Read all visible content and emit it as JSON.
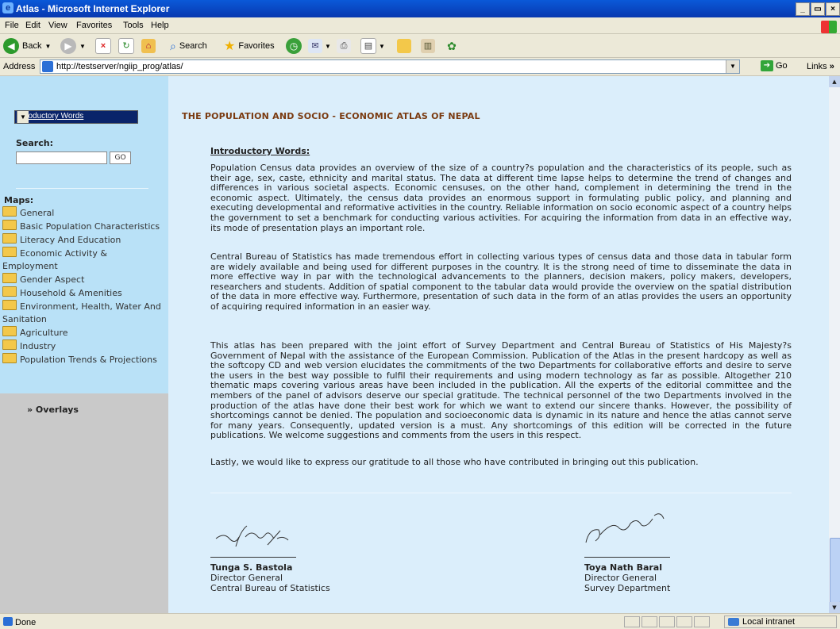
{
  "window": {
    "title": "Atlas - Microsoft Internet Explorer",
    "ie_icon": "ie-logo-icon",
    "controls": [
      "_",
      "🗗",
      "×"
    ]
  },
  "menu": [
    "File",
    "Edit",
    "View",
    "Favorites",
    "Tools",
    "Help"
  ],
  "toolbar": {
    "back": "Back",
    "search": "Search",
    "favorites": "Favorites"
  },
  "address": {
    "label": "Address",
    "url": "http://testserver/ngiip_prog/atlas/",
    "go": "Go",
    "links": "Links"
  },
  "sidebar": {
    "dropdown_value": "Introductory Words",
    "search_label": "Search:",
    "search_go": "GO",
    "maps_label": "Maps:",
    "maps": [
      "General",
      "Basic Population Characteristics",
      "Literacy And Education",
      "Economic Activity & Employment",
      "Gender Aspect",
      "Household & Amenities",
      "Environment, Health, Water And Sanitation",
      "Agriculture",
      "Industry",
      "Population Trends & Projections"
    ],
    "overlays": "» Overlays"
  },
  "main": {
    "title": "THE POPULATION AND SOCIO - ECONOMIC ATLAS OF NEPAL",
    "heading": "Introductory Words:",
    "paragraphs": [
      "Population Census data provides an overview of the size of a country?s population and the characteristics of its people, such as their age, sex, caste, ethnicity and marital status. The data at different time lapse helps to determine the trend of changes and differences in various societal aspects. Economic censuses, on the other hand, complement in determining the trend in the economic aspect. Ultimately, the census data provides an enormous support in formulating public policy, and planning and executing developmental and reformative activities in the country. Reliable information on socio economic aspect of a country helps the government to set a benchmark for conducting various activities. For acquiring the information from data in an effective way, its mode of presentation plays an important role.",
      "Central Bureau of Statistics has made tremendous effort in collecting various types of census data and those data in tabular form are widely available and being used for different purposes in the country. It is the strong need of time to disseminate the data in more effective way in par with the technological advancements to the planners, decision makers, policy makers, developers, researchers and students. Addition of spatial component to the tabular data would provide the overview on the spatial distribution of the data in more effective way. Furthermore, presentation of such data in the form of an atlas provides the users an opportunity of acquiring required information in an easier way.",
      "This atlas has been prepared with the joint effort of Survey Department and Central Bureau of Statistics of His Majesty?s Government of Nepal with the assistance of the European Commission. Publication of the Atlas in the present hardcopy as well as the softcopy CD and web version elucidates the commitments of the two Departments for collaborative efforts and desire to serve the users in the best way possible to fulfil their requirements and using modern technology as far as possible. Altogether 210 thematic maps covering various areas have been included in the publication. All the experts of the editorial committee and the members of the panel of advisors deserve our special gratitude. The technical personnel of the two Departments involved in the production of the atlas have done their best work for which we want to extend our sincere thanks. However, the possibility of shortcomings cannot be denied. The population and socioeconomic data is dynamic in its nature and hence the atlas cannot serve for many years. Consequently, updated version is a must. Any shortcomings of this edition will be corrected in the future publications. We welcome suggestions and comments from the users in this respect.",
      "Lastly, we would like to express our gratitude to all those who have contributed in bringing out this publication."
    ],
    "signatories": [
      {
        "name": "Tunga S. Bastola",
        "title": "Director General",
        "org": "Central Bureau of Statistics"
      },
      {
        "name": "Toya Nath Baral",
        "title": "Director General",
        "org": "Survey Department"
      }
    ]
  },
  "status": {
    "text": "Done",
    "zone": "Local intranet"
  }
}
